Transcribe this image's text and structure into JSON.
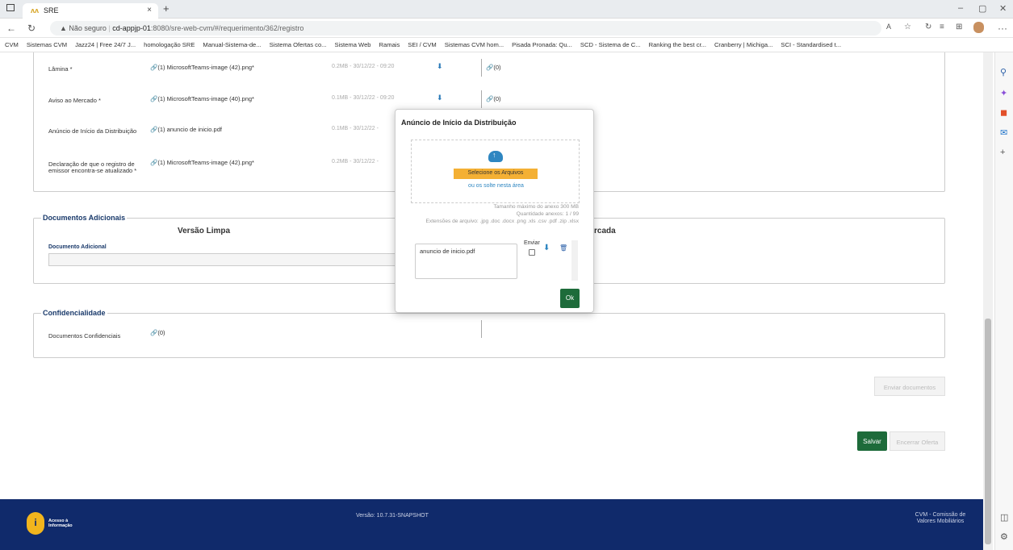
{
  "browser": {
    "tab_title": "SRE",
    "tab_logo": "ʌʌ",
    "url_warning": "▲ Não seguro",
    "url_host": "cd-appjp-01",
    "url_rest": ":8080/sre-web-cvm/#/requerimento/362/registro",
    "bookmarks": [
      "CVM",
      "Sistemas CVM",
      "Jazz24 | Free 24/7 J...",
      "homologação SRE",
      "Manual-Sistema-de...",
      "Sistema Ofertas co...",
      "Sistema Web",
      "Ramais",
      "SEI / CVM",
      "Sistemas CVM hom...",
      "Pisada Pronada: Qu...",
      "SCD - Sistema de C...",
      "Ranking the best cr...",
      "Cranberry | Michiga...",
      "SCI - Standardised t..."
    ]
  },
  "documents": [
    {
      "label": "Lâmina *",
      "file": "(1) MicrosoftTeams-image (42).png*",
      "meta": "0.2MB - 30/12/22 - 09:20",
      "count": "(0)"
    },
    {
      "label": "Aviso ao Mercado *",
      "file": "(1) MicrosoftTeams-image (40).png*",
      "meta": "0.1MB - 30/12/22 - 09:20",
      "count": "(0)"
    },
    {
      "label": "Anúncio de Início da Distribuição",
      "file": "(1) anuncio de inicio.pdf",
      "meta": "0.1MB - 30/12/22 -",
      "count": ""
    },
    {
      "label": "Declaração de que o registro de emissor encontra-se atualizado *",
      "file": "(1) MicrosoftTeams-image (42).png*",
      "meta": "0.2MB - 30/12/22 -",
      "count": ""
    }
  ],
  "adicionais": {
    "legend": "Documentos Adicionais",
    "col_limpa": "Versão Limpa",
    "col_marcada": "rcada",
    "doc_label": "Documento Adicional"
  },
  "confidencialidade": {
    "legend": "Confidencialidade",
    "label": "Documentos Confidenciais",
    "count": "(0)"
  },
  "buttons": {
    "enviar": "Enviar documentos",
    "salvar": "Salvar",
    "encerrar": "Encerrar Oferta"
  },
  "footer": {
    "acesso": "Acesso à Informação",
    "versao": "Versão: 10.7.31-SNAPSHOT",
    "cvm": "CVM - Comissão de Valores Mobiliários"
  },
  "modal": {
    "title": "Anúncio de Início da Distribuição",
    "select_btn": "Selecione os Arquivos",
    "drop_text": "ou os solte nesta área",
    "max_size": "Tamanho máximo do anexo 300 MB",
    "qty": "Quantidade anexos: 1 / 99",
    "ext": "Extensões de arquivo: .jpg .doc .docx .png .xls .csv .pdf .zip .xlsx",
    "file": "anuncio de inicio.pdf",
    "enviar_lbl": "Enviar",
    "ok": "Ok"
  }
}
